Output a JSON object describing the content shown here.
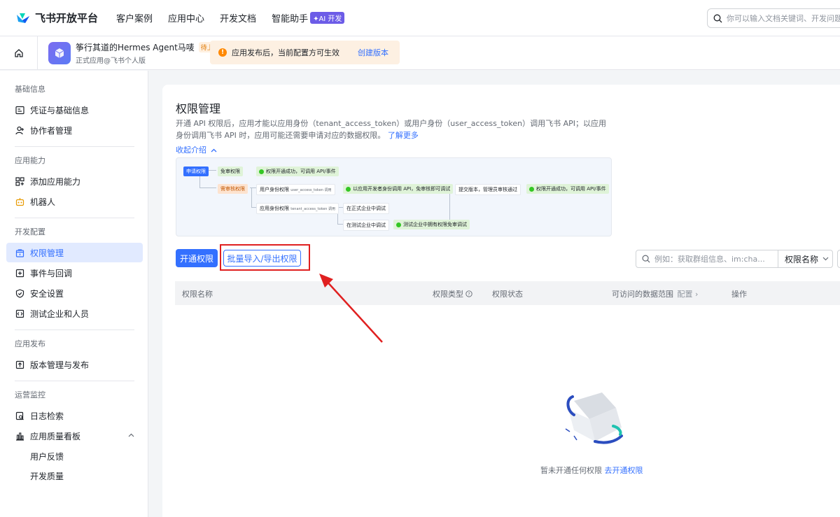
{
  "topnav": {
    "brand": "飞书开放平台",
    "links": [
      {
        "label": "客户案例"
      },
      {
        "label": "应用中心"
      },
      {
        "label": "开发文档"
      },
      {
        "label": "智能助手"
      }
    ],
    "ai_badge": "✦AI 开发",
    "search_placeholder": "你可以输入文档关键词、开发问题"
  },
  "app": {
    "name": "筝行其道的Hermes Agent马唛",
    "status_tag": "待上线",
    "subtitle": "正式应用@飞书个人版",
    "notice_text": "应用发布后，当前配置方可生效",
    "notice_link": "创建版本"
  },
  "sidebar": {
    "groups": [
      {
        "label": "基础信息",
        "items": [
          {
            "label": "凭证与基础信息",
            "icon": "id-card-icon"
          },
          {
            "label": "协作者管理",
            "icon": "user-add-icon"
          }
        ]
      },
      {
        "label": "应用能力",
        "items": [
          {
            "label": "添加应用能力",
            "icon": "grid-add-icon"
          },
          {
            "label": "机器人",
            "icon": "robot-icon"
          }
        ]
      },
      {
        "label": "开发配置",
        "items": [
          {
            "label": "权限管理",
            "icon": "lock-icon",
            "active": true
          },
          {
            "label": "事件与回调",
            "icon": "event-icon"
          },
          {
            "label": "安全设置",
            "icon": "shield-icon"
          },
          {
            "label": "测试企业和人员",
            "icon": "code-icon"
          }
        ]
      },
      {
        "label": "应用发布",
        "items": [
          {
            "label": "版本管理与发布",
            "icon": "upload-icon"
          }
        ]
      },
      {
        "label": "运营监控",
        "items": [
          {
            "label": "日志检索",
            "icon": "log-search-icon"
          },
          {
            "label": "应用质量看板",
            "icon": "chart-icon"
          }
        ]
      }
    ],
    "sub_items": [
      "用户反馈",
      "开发质量"
    ]
  },
  "main": {
    "title": "权限管理",
    "description": "开通 API 权限后，应用才能以应用身份（tenant_access_token）或用户身份（user_access_token）调用飞书 API；以应用身份调用飞书 API 时，应用可能还需要申请对应的数据权限。",
    "learn_more": "了解更多",
    "collapse_label": "收起介绍",
    "flow": {
      "apply": "申请权限",
      "free": "免审权限",
      "free_result": "权限开通成功，可调用 API/事件",
      "review": "需审核权限",
      "user_token": "用户身份权限",
      "user_token_sub": "user_access_token 调用",
      "user_token_result": "以应用开发者身份调用 API，免审核即可调试",
      "submit": "提交版本，管理员审核通过",
      "final_result": "权限开通成功，可调用 API/事件",
      "tenant_token": "应用身份权限",
      "tenant_token_sub": "tenant_access_token 调用",
      "formal": "在正式企业中调试",
      "test": "在测试企业中调试",
      "test_result": "测试企业中拥有权限免审调试"
    },
    "btn_open": "开通权限",
    "btn_batch": "批量导入/导出权限",
    "search_placeholder": "例如：获取群组信息、im:cha...",
    "select_label": "权限名称",
    "table_headers": {
      "name": "权限名称",
      "type": "权限类型",
      "status": "权限状态",
      "scope": "可访问的数据范围",
      "scope_config": "配置",
      "action": "操作"
    },
    "empty_text": "暂未开通任何权限",
    "empty_link": "去开通权限"
  },
  "colors": {
    "primary": "#3370ff",
    "highlight_box": "#e02020",
    "active_bg": "#e1eaff"
  }
}
